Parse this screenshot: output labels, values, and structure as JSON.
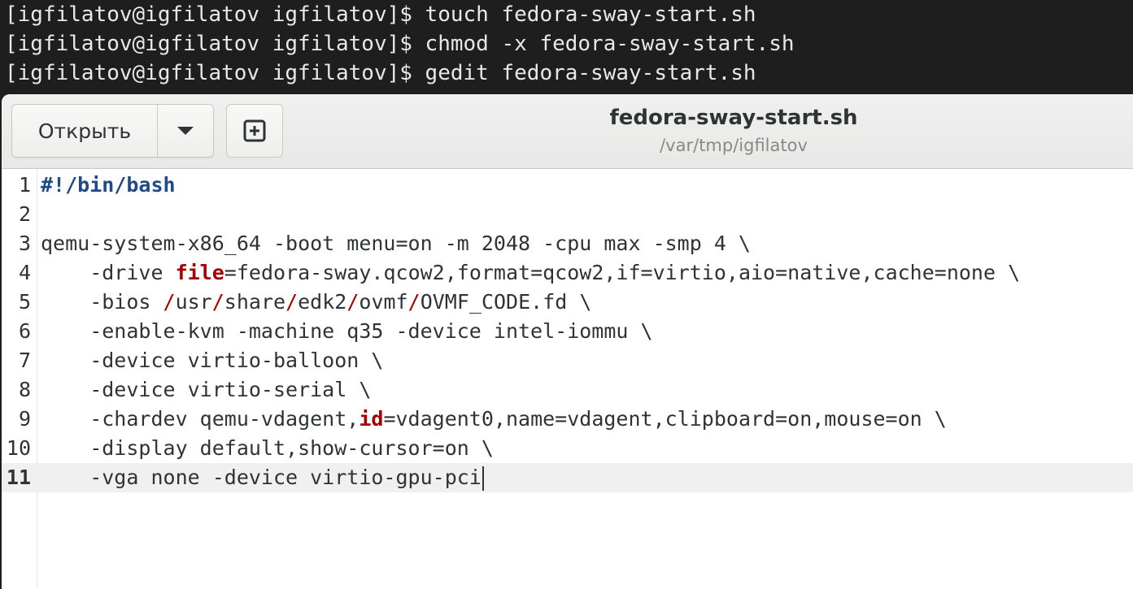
{
  "terminal": {
    "lines": [
      "[igfilatov@igfilatov igfilatov]$ touch fedora-sway-start.sh",
      "[igfilatov@igfilatov igfilatov]$ chmod -x fedora-sway-start.sh",
      "[igfilatov@igfilatov igfilatov]$ gedit fedora-sway-start.sh"
    ]
  },
  "gedit": {
    "open_label": "Открыть",
    "dropdown_icon": "chevron-down-icon",
    "new_tab_icon": "new-document-icon",
    "title": "fedora-sway-start.sh",
    "path": "/var/tmp/igfilatov",
    "current_line": 11,
    "colors": {
      "shebang": "#204a87",
      "keyword": "#a40000",
      "current_line_bg": "#f0f0f0"
    }
  },
  "editor": {
    "line_numbers": [
      "1",
      "2",
      "3",
      "4",
      "5",
      "6",
      "7",
      "8",
      "9",
      "10",
      "11"
    ],
    "lines": {
      "l1": "#!/bin/bash",
      "l2": "",
      "l3": "qemu-system-x86_64 -boot menu=on -m 2048 -cpu max -smp 4 \\",
      "l4_a": "    -drive ",
      "l4_kw": "file",
      "l4_b": "=fedora-sway.qcow2,format=qcow2,if=virtio,aio=native,cache=none \\",
      "l5_a": "    -bios ",
      "l5_s1": "/",
      "l5_p1": "usr",
      "l5_s2": "/",
      "l5_p2": "share",
      "l5_s3": "/",
      "l5_p3": "edk2",
      "l5_s4": "/",
      "l5_p4": "ovmf",
      "l5_s5": "/",
      "l5_p5": "OVMF_CODE.fd \\",
      "l6": "    -enable-kvm -machine q35 -device intel-iommu \\",
      "l7": "    -device virtio-balloon \\",
      "l8": "    -device virtio-serial \\",
      "l9_a": "    -chardev qemu-vdagent,",
      "l9_kw": "id",
      "l9_b": "=vdagent0,name=vdagent,clipboard=on,mouse=on \\",
      "l10": "    -display default,show-cursor=on \\",
      "l11": "    -vga none -device virtio-gpu-pci"
    }
  }
}
